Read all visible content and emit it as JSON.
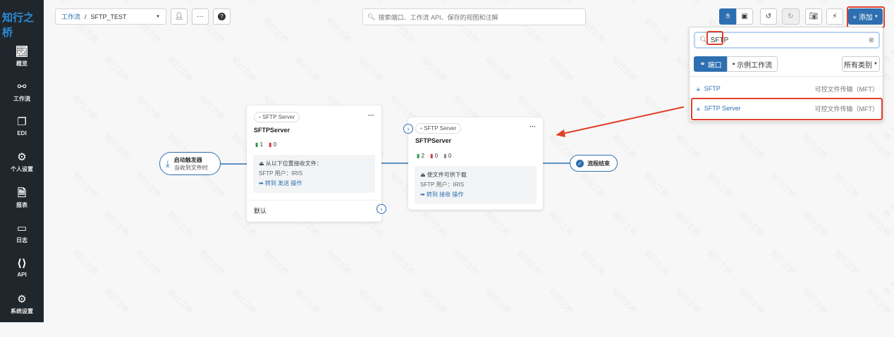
{
  "brand": "知行之桥",
  "sidebar": {
    "items": [
      {
        "label": "概览",
        "icon": "chart-line-icon"
      },
      {
        "label": "工作流",
        "icon": "share-nodes-icon"
      },
      {
        "label": "EDI",
        "icon": "copy-icon"
      },
      {
        "label": "个人设置",
        "icon": "gears-icon"
      },
      {
        "label": "报表",
        "icon": "file-icon"
      },
      {
        "label": "日志",
        "icon": "layers-icon"
      },
      {
        "label": "API",
        "icon": "file-code-icon"
      },
      {
        "label": "系统设置",
        "icon": "gear-icon"
      }
    ]
  },
  "breadcrumb": {
    "root": "工作流",
    "separator": "/",
    "current": "SFTP_TEST"
  },
  "search": {
    "placeholder": "搜索端口、工作流 API、保存的视图和注解"
  },
  "toolbar": {
    "add_label": "+ 添加"
  },
  "panel": {
    "search_value": "SFTP",
    "tabs": [
      {
        "label": "端口",
        "active": true
      },
      {
        "label": "示例工作流",
        "active": false
      }
    ],
    "category_select": "所有类别",
    "results": [
      {
        "name": "SFTP",
        "category": "可控文件传输（MFT）"
      },
      {
        "name": "SFTP Server",
        "category": "可控文件传输（MFT）",
        "highlighted": true
      }
    ]
  },
  "trigger": {
    "title": "启动触发器",
    "subtitle": "当收到文件时"
  },
  "nodes": [
    {
      "type": "SFTP Server",
      "name": "SFTPServer",
      "stats": [
        "1",
        "0"
      ],
      "action": "从以下位置接收文件：",
      "detail": "SFTP 用户：IRIS",
      "link": "➡ 转到 发送 操作",
      "footer": "默认"
    },
    {
      "type": "SFTP Server",
      "name": "SFTPServer",
      "stats": [
        "2",
        "0",
        "0"
      ],
      "action": "使文件可供下载",
      "detail": "SFTP 用户：IRIS",
      "link": "➡ 转到 接收 操作"
    }
  ],
  "end": {
    "label": "流程结束"
  },
  "colors": {
    "accent": "#2d6fb0",
    "sidebar": "#1f272d",
    "annotation": "#e0402a"
  }
}
